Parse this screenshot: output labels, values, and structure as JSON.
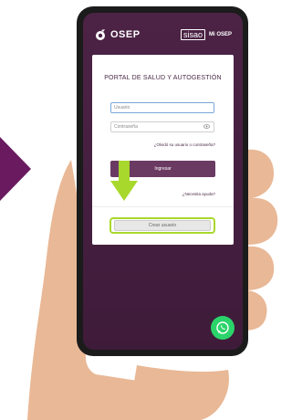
{
  "header": {
    "brand": "OSEP",
    "sisao": "sisao",
    "mi_osep": "Mi OSEP"
  },
  "login": {
    "title": "PORTAL DE SALUD Y AUTOGESTIÓN",
    "user_placeholder": "Usuario",
    "password_placeholder": "Contraseña",
    "forgot_text": "¿Olvidó su usuario o contraseña?",
    "login_label": "Ingresar",
    "help_text": "¿Necesita ayuda?",
    "create_label": "Crear usuario"
  },
  "icons": {
    "brand": "osep-logo-icon",
    "eye": "eye-icon",
    "whatsapp": "whatsapp-icon",
    "left_arrow": "arrow-right-icon",
    "green_arrow": "arrow-down-icon"
  },
  "colors": {
    "screen_bg": "#4c2345",
    "button_purple": "#6b3a63",
    "highlight_green": "#a8d82c",
    "whatsapp_green": "#2bd46a"
  }
}
